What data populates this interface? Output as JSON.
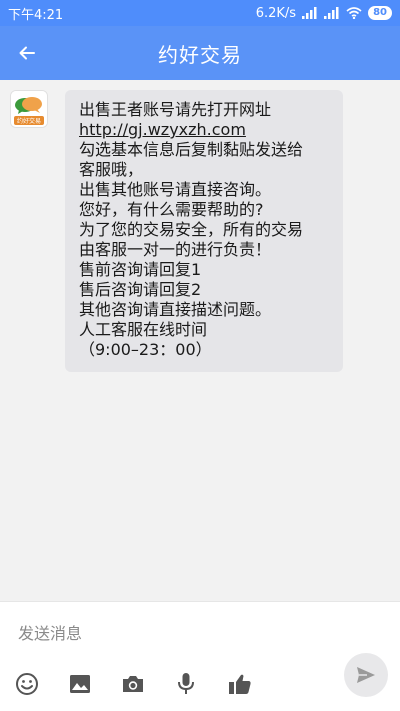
{
  "status_bar": {
    "time": "下午4:21",
    "network_speed": "6.2K/s",
    "battery": "80",
    "icons": [
      "signal-icon",
      "signal-icon",
      "wifi-icon",
      "battery-icon"
    ]
  },
  "header": {
    "title": "约好交易",
    "back_icon": "back-arrow-icon",
    "color": "#5a93f7"
  },
  "chat": {
    "avatar_label": "约好交易",
    "message_lines": [
      "出售王者账号请先打开网址",
      "http://gj.wzyxzh.com",
      "勾选基本信息后复制黏贴发送给",
      "客服哦，",
      "出售其他账号请直接咨询。",
      "您好，有什么需要帮助的?",
      "为了您的交易安全，所有的交易",
      "由客服一对一的进行负责！",
      "售前咨询请回复1",
      "售后咨询请回复2",
      "其他咨询请直接描述问题。",
      "人工客服在线时间",
      "（9:00–23：00）"
    ]
  },
  "composer": {
    "placeholder": "发送消息",
    "tools": [
      "emoji-icon",
      "image-icon",
      "camera-icon",
      "microphone-icon",
      "thumbs-up-icon"
    ],
    "send_icon": "send-icon"
  }
}
